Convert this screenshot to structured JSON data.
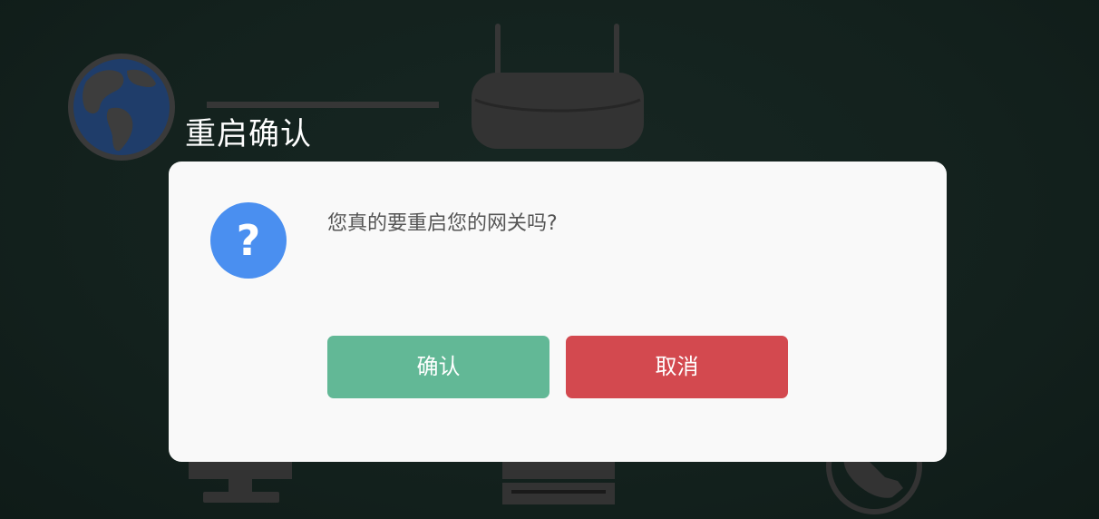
{
  "dialog": {
    "title": "重启确认",
    "message": "您真的要重启您的网关吗?",
    "icon": "question-icon",
    "confirm_label": "确认",
    "cancel_label": "取消"
  },
  "colors": {
    "background": "#14231f",
    "dialog_bg": "#f9f9f9",
    "icon_blue": "#4a8ff0",
    "confirm": "#62b896",
    "cancel": "#d3494f"
  },
  "background_icons": [
    "globe-icon",
    "router-icon",
    "monitor-icon",
    "computer-icon",
    "phone-icon"
  ]
}
